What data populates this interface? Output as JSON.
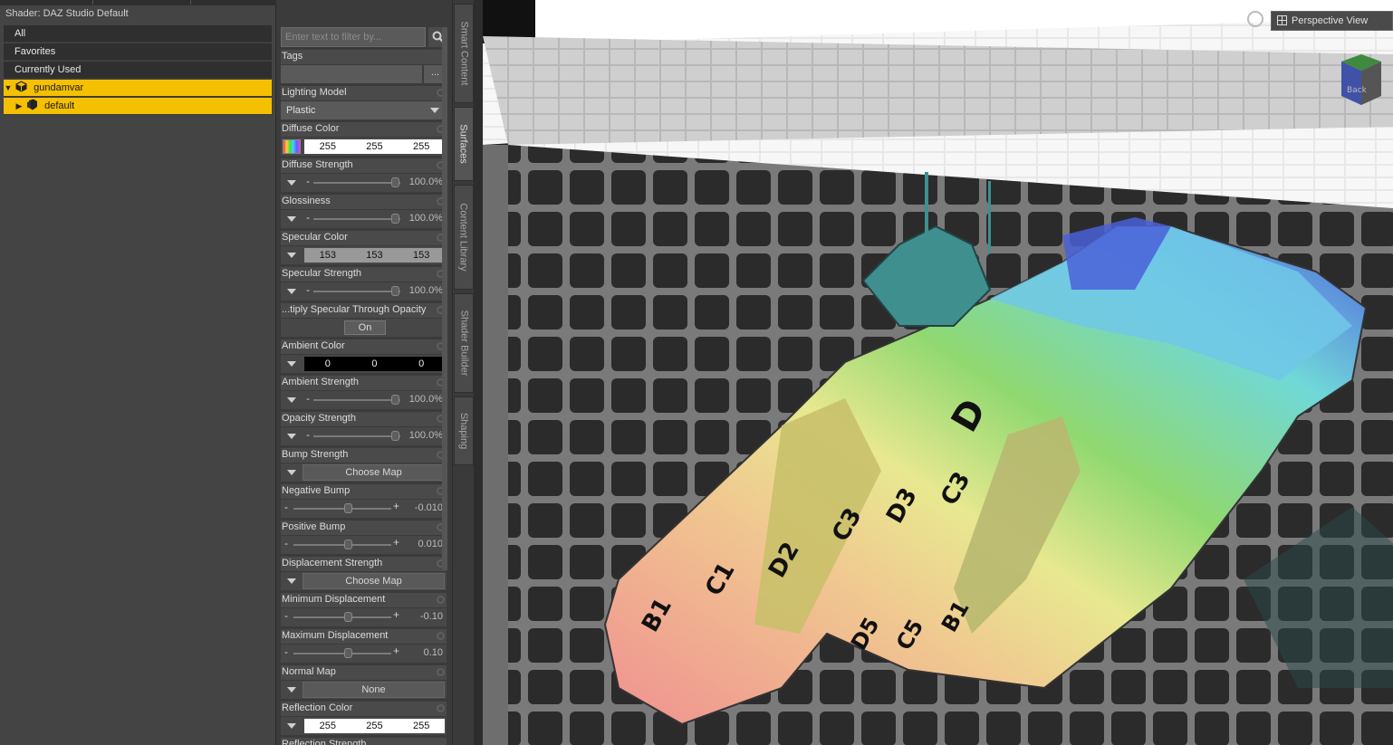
{
  "header": {
    "shader_title": "Shader: DAZ Studio Default"
  },
  "tree": {
    "items": [
      {
        "label": "All"
      },
      {
        "label": "Favorites"
      },
      {
        "label": "Currently Used"
      },
      {
        "label": "gundamvar"
      },
      {
        "label": "default"
      }
    ]
  },
  "filter": {
    "placeholder": "Enter text to filter by..."
  },
  "props": {
    "tags": {
      "label": "Tags",
      "button": "..."
    },
    "lighting_model": {
      "label": "Lighting Model",
      "value": "Plastic"
    },
    "diffuse_color": {
      "label": "Diffuse Color",
      "r": "255",
      "g": "255",
      "b": "255"
    },
    "diffuse_strength": {
      "label": "Diffuse Strength",
      "value": "100.0%"
    },
    "glossiness": {
      "label": "Glossiness",
      "value": "100.0%"
    },
    "specular_color": {
      "label": "Specular Color",
      "r": "153",
      "g": "153",
      "b": "153"
    },
    "specular_strength": {
      "label": "Specular Strength",
      "value": "100.0%"
    },
    "mult_spec": {
      "label": "...tiply Specular Through Opacity",
      "value": "On"
    },
    "ambient_color": {
      "label": "Ambient Color",
      "r": "0",
      "g": "0",
      "b": "0"
    },
    "ambient_strength": {
      "label": "Ambient Strength",
      "value": "100.0%"
    },
    "opacity_strength": {
      "label": "Opacity Strength",
      "value": "100.0%"
    },
    "bump_strength": {
      "label": "Bump Strength",
      "button": "Choose Map"
    },
    "negative_bump": {
      "label": "Negative Bump",
      "value": "-0.010"
    },
    "positive_bump": {
      "label": "Positive Bump",
      "value": "0.010"
    },
    "displacement_strength": {
      "label": "Displacement Strength",
      "button": "Choose Map"
    },
    "min_displacement": {
      "label": "Minimum Displacement",
      "value": "-0.10"
    },
    "max_displacement": {
      "label": "Maximum Displacement",
      "value": "0.10"
    },
    "normal_map": {
      "label": "Normal Map",
      "button": "None"
    },
    "reflection_color": {
      "label": "Reflection Color",
      "r": "255",
      "g": "255",
      "b": "255"
    },
    "reflection_strength": {
      "label": "Reflection Strength"
    }
  },
  "side_tabs": [
    "Smart Content",
    "Surfaces",
    "Content Library",
    "Shader Builder",
    "Shaping"
  ],
  "viewport": {
    "view_label": "Perspective View",
    "cube_face": "Back"
  },
  "colors": {
    "selection": "#f5c000",
    "panel": "#3b3b3b"
  }
}
